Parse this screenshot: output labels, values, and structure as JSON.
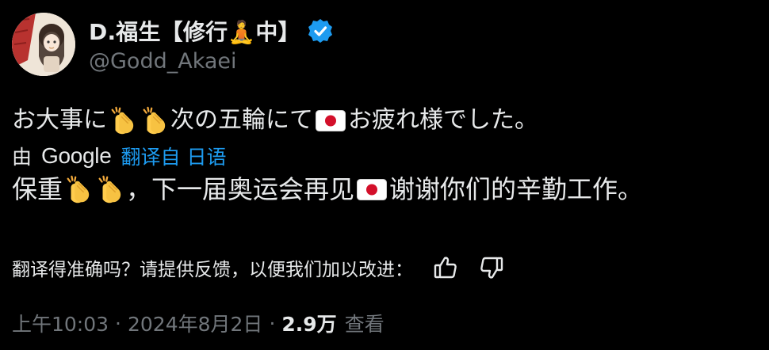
{
  "author": {
    "display_name": "D.福生【修行🧘中】",
    "handle": "@Godd_Akaei",
    "verified": true
  },
  "post": {
    "original_segments": {
      "part1": "お大事に",
      "part2": "次の五輪にて",
      "part3": "お疲れ様でした。"
    },
    "translated_by_label": "由",
    "translator": "Google",
    "translate_from": "翻译自 日语",
    "translation_segments": {
      "part1": "保重",
      "part2": "，下一届奥运会再见",
      "part3": "谢谢你们的辛勤工作。"
    }
  },
  "feedback": {
    "question": "翻译得准确吗？请提供反馈，以便我们加以改进：",
    "up_icon": "thumbs-up-icon",
    "down_icon": "thumbs-down-icon"
  },
  "meta": {
    "time": "上午10:03",
    "separator": "·",
    "date": "2024年8月2日",
    "views_count": "2.9万",
    "views_label": "查看"
  },
  "colors": {
    "background": "#000000",
    "text": "#e7e9ea",
    "muted": "#71767b",
    "link": "#1d9bf0",
    "verified": "#1d9bf0"
  }
}
